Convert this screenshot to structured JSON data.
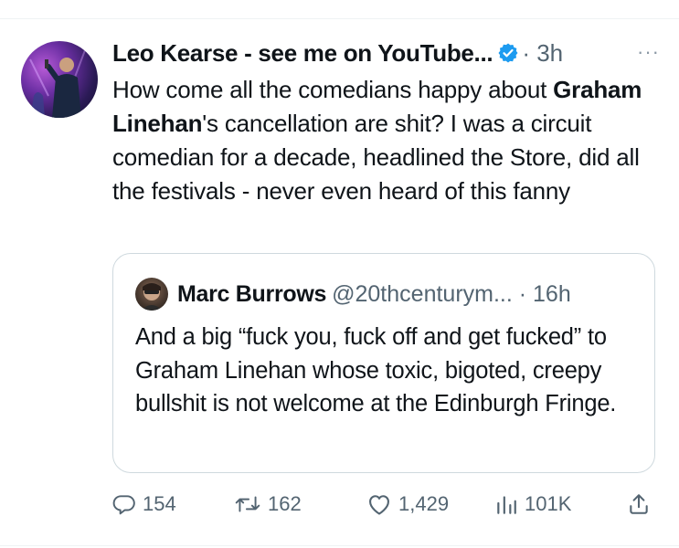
{
  "tweet": {
    "author_name": "Leo Kearse - see me on YouTube...",
    "meta": "· 3h",
    "more": "···",
    "text_part1": "How come all the comedians happy about ",
    "text_bold": "Graham Linehan",
    "text_part2": "'s cancellation are shit? I was a circuit comedian for a decade, headlined the Store, did all the festivals - never even heard of this fanny",
    "verified_color": "#1d9bf0"
  },
  "quote": {
    "author_name": "Marc Burrows",
    "meta": "@20thcenturym... · 16h",
    "text": "And a big “fuck you, fuck off and get fucked” to Graham Linehan whose toxic, bigoted, creepy bullshit is not welcome at the Edinburgh Fringe."
  },
  "actions": {
    "reply_icon": "reply-icon",
    "reply_count": "154",
    "retweet_icon": "retweet-icon",
    "retweet_count": "162",
    "like_icon": "like-icon",
    "like_count": "1,429",
    "views_icon": "views-icon",
    "views_count": "101K",
    "share_icon": "share-icon"
  },
  "colors": {
    "text": "#0f1419",
    "secondary": "#536471",
    "border": "#cfd9de"
  }
}
